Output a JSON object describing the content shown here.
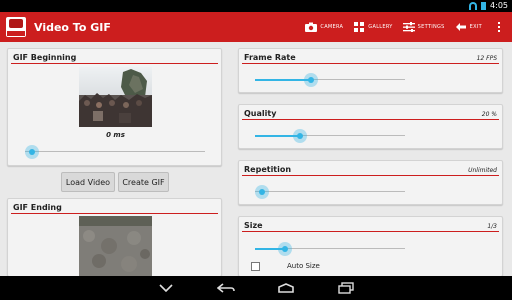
{
  "status_bar": {
    "time": "4:05"
  },
  "action_bar": {
    "title": "Video To GIF",
    "logo_text": "VIDEO TO GIF",
    "actions": [
      {
        "name": "camera",
        "label": "CAMERA",
        "icon": "camera-icon"
      },
      {
        "name": "gallery",
        "label": "GALLERY",
        "icon": "gallery-icon"
      },
      {
        "name": "settings",
        "label": "SETTINGS",
        "icon": "sliders-icon"
      },
      {
        "name": "exit",
        "label": "EXIT",
        "icon": "exit-icon"
      }
    ],
    "overflow_icon": "overflow-icon"
  },
  "gif_beginning": {
    "title": "GIF Beginning",
    "time": "0 ms",
    "slider_fraction": 0.0
  },
  "buttons": {
    "load_video": "Load Video",
    "create_gif": "Create GIF"
  },
  "gif_ending": {
    "title": "GIF Ending"
  },
  "settings": {
    "frame_rate": {
      "title": "Frame Rate",
      "value": "12 FPS",
      "slider_fraction": 0.37
    },
    "quality": {
      "title": "Quality",
      "value": "20 %",
      "slider_fraction": 0.3
    },
    "repetition": {
      "title": "Repetition",
      "value": "Unlimited",
      "slider_fraction": 0.0
    },
    "size": {
      "title": "Size",
      "value": "1/3",
      "slider_fraction": 0.2,
      "auto_size_label": "Auto Size",
      "auto_size_checked": false
    }
  },
  "colors": {
    "accent": "#cc1e1e",
    "slider": "#33b5e5"
  },
  "nav_bar": {
    "icons": [
      "collapse-icon",
      "back-icon",
      "home-icon",
      "recents-icon"
    ]
  }
}
